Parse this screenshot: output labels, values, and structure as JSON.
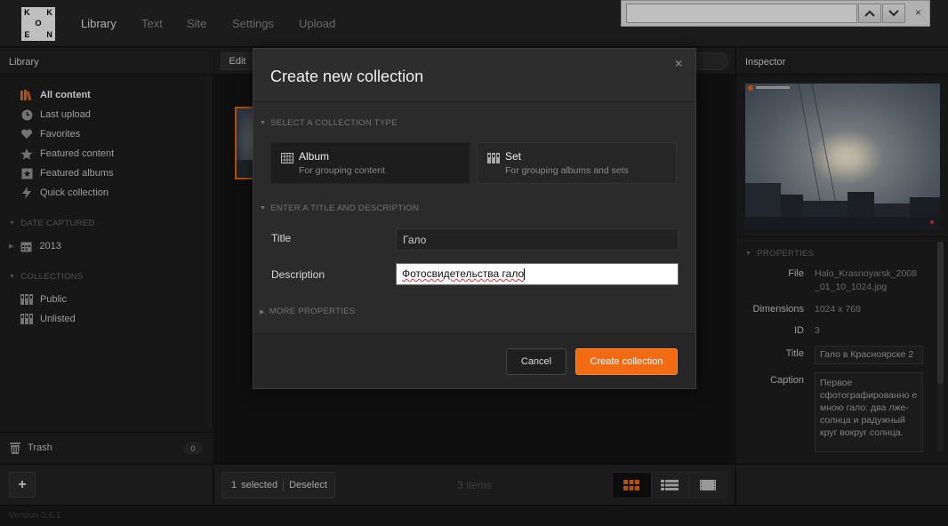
{
  "app": {
    "logo_letters": [
      "K",
      "",
      "K",
      "",
      "O",
      "",
      "E",
      "",
      "N"
    ]
  },
  "nav": [
    {
      "label": "Library",
      "active": true
    },
    {
      "label": "Text"
    },
    {
      "label": "Site"
    },
    {
      "label": "Settings"
    },
    {
      "label": "Upload"
    }
  ],
  "findbar": {
    "value": "",
    "close": "×"
  },
  "library": {
    "header": "Library",
    "items": [
      {
        "label": "All content",
        "icon": "library-icon",
        "active": true
      },
      {
        "label": "Last upload",
        "icon": "clock-icon"
      },
      {
        "label": "Favorites",
        "icon": "heart-icon"
      },
      {
        "label": "Featured content",
        "icon": "star-icon"
      },
      {
        "label": "Featured albums",
        "icon": "featured-album-icon"
      },
      {
        "label": "Quick collection",
        "icon": "bolt-icon"
      }
    ],
    "date_section": "DATE CAPTURED",
    "date_items": [
      {
        "label": "2013",
        "icon": "calendar-icon"
      }
    ],
    "collections_section": "COLLECTIONS",
    "collection_items": [
      {
        "label": "Public",
        "icon": "set-icon"
      },
      {
        "label": "Unlisted",
        "icon": "set-icon"
      }
    ],
    "trash": {
      "label": "Trash",
      "count": "0"
    }
  },
  "content": {
    "edit_label": "Edit",
    "selected_count": "1",
    "selected_label": "selected",
    "deselect_label": "Deselect",
    "item_count": "3 items"
  },
  "inspector": {
    "header": "Inspector",
    "properties_section": "PROPERTIES",
    "props": {
      "file_label": "File",
      "file_value_line1": "Halo_Krasnoyarsk_2008",
      "file_value_line2": "_01_10_1024.jpg",
      "dimensions_label": "Dimensions",
      "dimensions_value": "1024 x 768",
      "id_label": "ID",
      "id_value": "3",
      "title_label": "Title",
      "title_value": "Гало в Красноярске 2",
      "caption_label": "Caption",
      "caption_value": "Первое сфотографированно е мною гало: два лже-солнца и радужный круг вокруг солнца."
    }
  },
  "footer": {
    "version": "Version 0.6.1",
    "add_label": "+"
  },
  "modal": {
    "title": "Create new collection",
    "close": "×",
    "type_section": "SELECT A COLLECTION TYPE",
    "types": [
      {
        "name": "Album",
        "desc": "For grouping content",
        "icon": "album-icon"
      },
      {
        "name": "Set",
        "desc": "For grouping albums and sets",
        "icon": "set-icon"
      }
    ],
    "details_section": "ENTER A TITLE AND DESCRIPTION",
    "title_label": "Title",
    "title_value": "Гало",
    "description_label": "Description",
    "description_value": "Фотосвидетельства гало",
    "more_section": "MORE PROPERTIES",
    "cancel_label": "Cancel",
    "create_label": "Create collection",
    "accent": "#f26a11"
  }
}
